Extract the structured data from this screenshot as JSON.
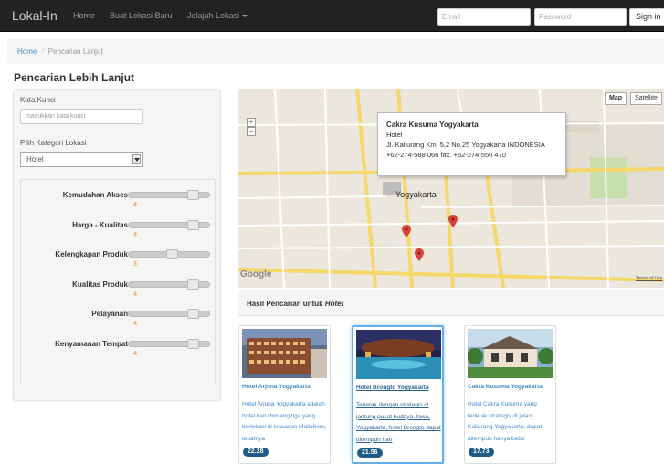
{
  "navbar": {
    "brand": "Lokal-In",
    "links": [
      "Home",
      "Buat Lokasi Baru",
      "Jelajah Lokasi"
    ],
    "email_placeholder": "Email",
    "password_placeholder": "Password",
    "signin_label": "Sign in"
  },
  "breadcrumb": {
    "home": "Home",
    "separator": "/",
    "current": "Pencarian Lanjut"
  },
  "page_title": "Pencarian Lebih Lanjut",
  "filters": {
    "keyword_label": "Kata Kunci",
    "keyword_placeholder": "masukkan kata kunci",
    "category_label": "Pilih Kategori Lokasi",
    "category_value": "Hotel",
    "criteria": [
      {
        "label": "Kemudahan Akses",
        "value": "4",
        "level": 0.78
      },
      {
        "label": "Harga - Kualitas",
        "value": "4",
        "level": 0.78
      },
      {
        "label": "Kelengkapan Produk",
        "value": "3",
        "level": 0.52
      },
      {
        "label": "Kualitas Produk",
        "value": "4",
        "level": 0.78
      },
      {
        "label": "Pelayanan",
        "value": "4",
        "level": 0.78
      },
      {
        "label": "Kenyamanan Tempat",
        "value": "4",
        "level": 0.78
      }
    ]
  },
  "map": {
    "type_buttons": [
      "Map",
      "Satellite"
    ],
    "info_title": "Cakra Kusuma Yogyakarta",
    "info_type": "Hotel",
    "info_address": "Jl. Kaliurang Km. 5,2 No.25 Yogyakarta INDONESIA",
    "info_phone": "+62-274-588 066 fax. +62-274-550 470",
    "city_label": "Yogyakarta",
    "logo": "Google",
    "terms": "Terms of Use",
    "zoom_in": "+",
    "zoom_out": "−"
  },
  "results": {
    "heading_prefix": "Hasil Pencarian untuk ",
    "heading_term": "Hotel",
    "cards": [
      {
        "title": "Hotel Arjuna Yogyakarta",
        "desc": "Hotel Arjuna Yogyakarta adalah hotel baru bintang tiga yang berlokasi di kawasan Malioboro, tepatnya",
        "score": "22.28"
      },
      {
        "title": "Hotel Brongto Yogyakarta",
        "desc": "Terletak dengan strategis di jantung pusat budaya Jawa, Yogyakarta, hotel Brongto dapat ditempuh han",
        "score": "21.56"
      },
      {
        "title": "Cakra Kusuma Yogyakarta",
        "desc": "Hotel Cakra Kusuma yang terletak strategis di jalan Kaliurang Yogyakarta, dapat ditempuh hanya bebe",
        "score": "17.73"
      }
    ]
  },
  "colors": {
    "accent": "#428bca",
    "badge": "#1f5b86",
    "slider_value": "#f0ad4e",
    "pin": "#d9413a"
  }
}
